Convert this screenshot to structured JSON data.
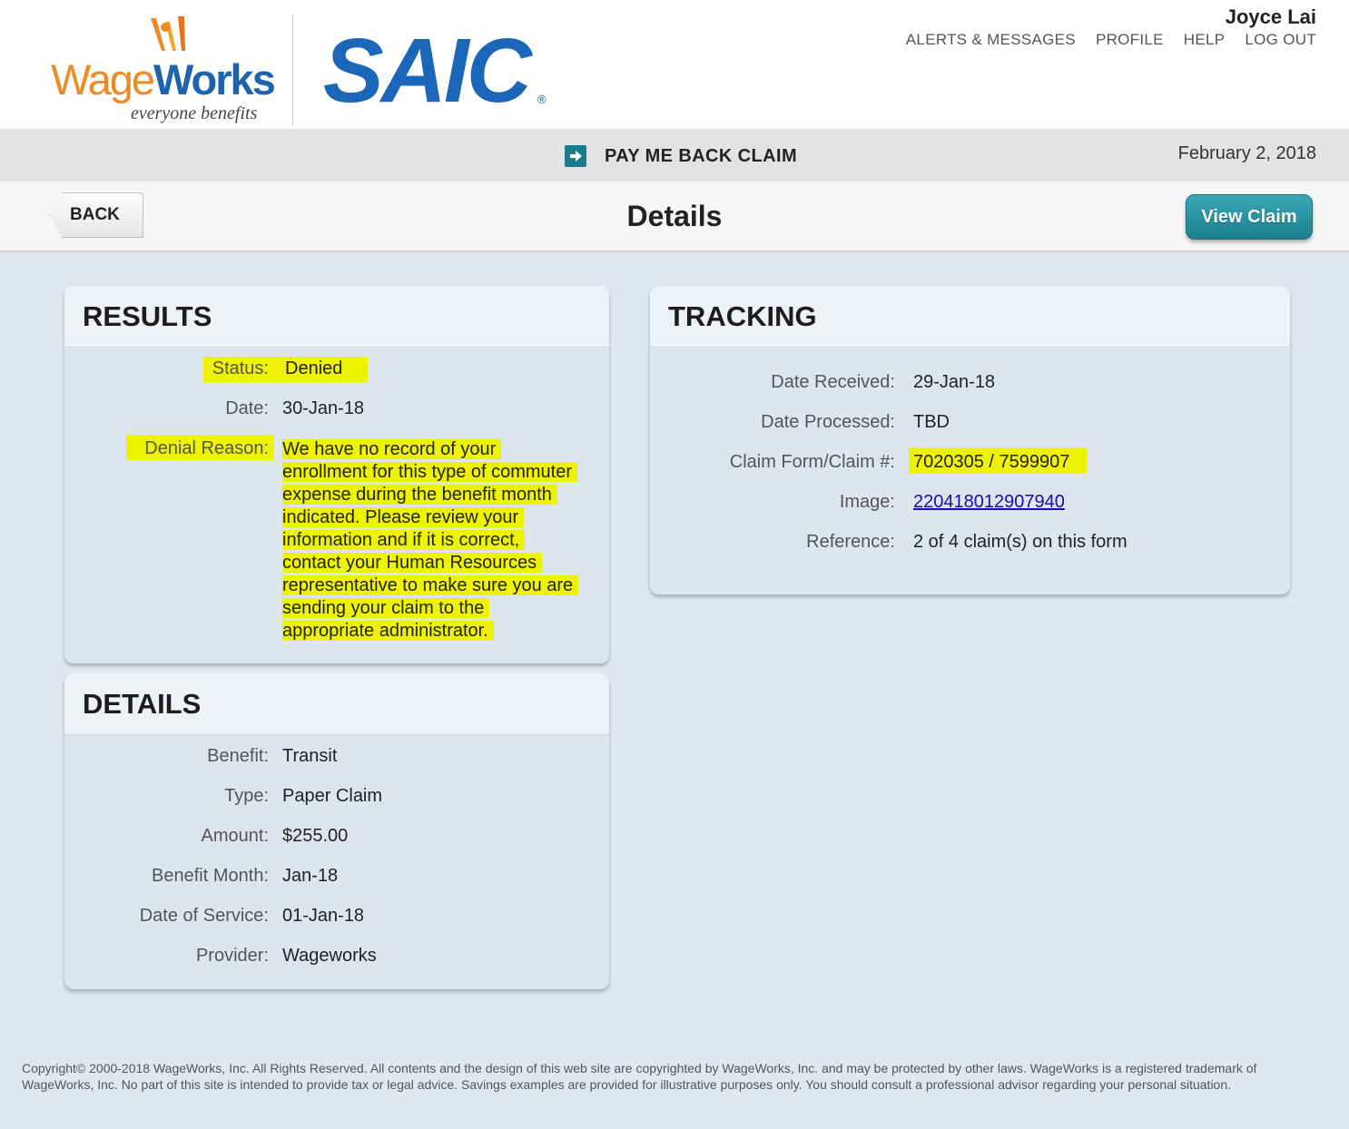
{
  "header": {
    "logo_wage": "Wage",
    "logo_works": "Works",
    "logo_tagline": "everyone benefits",
    "partner_logo": "SAIC",
    "partner_reg": "®",
    "user_name": "Joyce Lai",
    "nav": [
      "ALERTS & MESSAGES",
      "PROFILE",
      "HELP",
      "LOG OUT"
    ]
  },
  "band": {
    "title": "PAY ME BACK CLAIM",
    "date": "February 2, 2018",
    "icon": "arrow-right-icon"
  },
  "toolbar": {
    "back_label": "BACK",
    "page_title": "Details",
    "view_claim_label": "View Claim"
  },
  "results": {
    "title": "RESULTS",
    "status_label": "Status:",
    "status_value": "Denied",
    "date_label": "Date:",
    "date_value": "30-Jan-18",
    "denial_label": "Denial Reason:",
    "denial_lines": [
      "We have no record of your",
      "enrollment for this type of commuter",
      "expense during the benefit month",
      "indicated. Please review your",
      "information and if it is correct,",
      "contact your Human Resources",
      "representative to make sure you are",
      "sending your claim to the",
      "appropriate administrator."
    ]
  },
  "details": {
    "title": "DETAILS",
    "rows": [
      {
        "label": "Benefit:",
        "value": "Transit"
      },
      {
        "label": "Type:",
        "value": "Paper Claim"
      },
      {
        "label": "Amount:",
        "value": "$255.00"
      },
      {
        "label": "Benefit Month:",
        "value": "Jan-18"
      },
      {
        "label": "Date of Service:",
        "value": "01-Jan-18"
      },
      {
        "label": "Provider:",
        "value": "Wageworks"
      }
    ]
  },
  "tracking": {
    "title": "TRACKING",
    "received_label": "Date Received:",
    "received_value": "29-Jan-18",
    "processed_label": "Date Processed:",
    "processed_value": "TBD",
    "claim_label": "Claim Form/Claim #:",
    "claim_value": "7020305 / 7599907",
    "image_label": "Image:",
    "image_value": "220418012907940",
    "reference_label": "Reference:",
    "reference_value": "2 of 4 claim(s) on this form"
  },
  "footer": {
    "text": "Copyright© 2000-2018 WageWorks, Inc. All Rights Reserved. All contents and the design of this web site are copyrighted by WageWorks, Inc. and may be protected by other laws. WageWorks is a registered trademark of WageWorks, Inc. No part of this site is intended to provide tax or legal advice. Savings examples are provided for illustrative purposes only. You should consult a professional advisor regarding your personal situation."
  },
  "colors": {
    "accent_teal": "#1b7f8c",
    "brand_orange": "#f08a24",
    "brand_blue": "#1e63b0",
    "highlight_yellow": "#eef300",
    "page_bg": "#dfe8ef"
  }
}
